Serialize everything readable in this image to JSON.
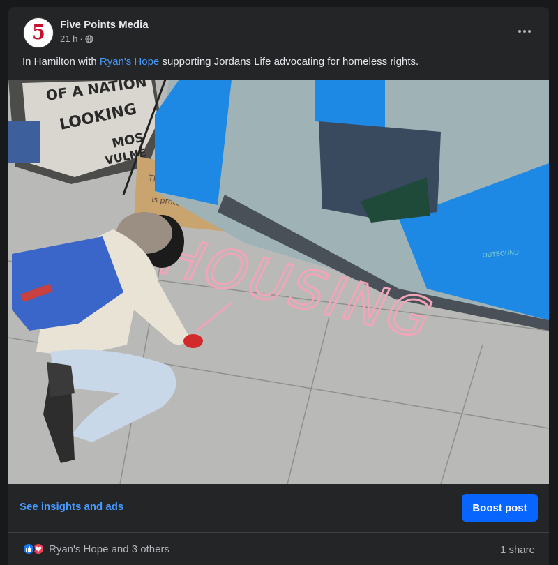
{
  "post": {
    "page_name": "Five Points Media",
    "avatar_mark": "5",
    "time": "21 h",
    "dot": "·",
    "caption": {
      "prefix": "In Hamilton with ",
      "mention": "Ryan's Hope",
      "suffix": " supporting Jordans Life advocating for homeless rights."
    },
    "more_icon": "more-horizontal-icon",
    "privacy_icon": "globe-icon"
  },
  "photo": {
    "banner_text": [
      "OF A NATION",
      "LOOKING",
      "MOS",
      "VULNE"
    ],
    "cardboard_sign": [
      "This tent",
      "is protected"
    ],
    "chalk_text": "HOUSING",
    "tent_brand": "OUTBOUND"
  },
  "actions": {
    "insights_label": "See insights and ads",
    "boost_label": "Boost post"
  },
  "stats": {
    "reactions_text": "Ryan's Hope and 3 others",
    "shares_text": "1 share",
    "reaction_icons": [
      "like-icon",
      "love-icon"
    ]
  },
  "colors": {
    "background": "#18191a",
    "card": "#242526",
    "link": "#4599ff",
    "boost": "#0866ff",
    "chalk": "#f2a5b8",
    "tent_blue": "#1e88e5"
  }
}
